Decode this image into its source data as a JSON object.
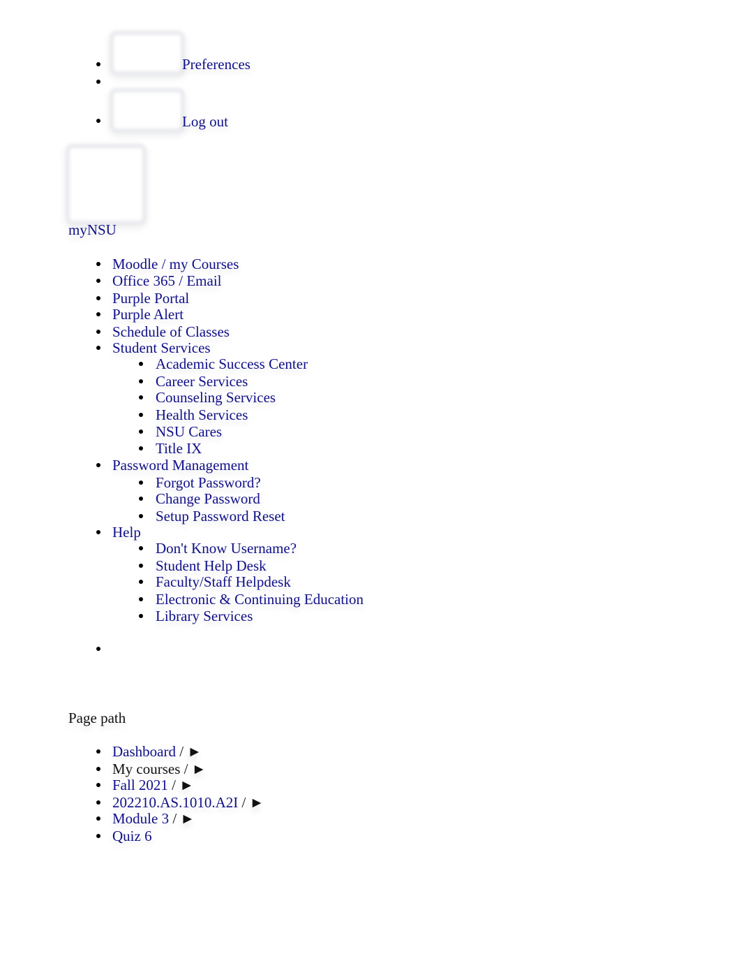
{
  "user_menu": {
    "items": [
      {
        "label": "Preferences",
        "icon": "preferences-icon-placeholder"
      },
      {
        "label": ""
      },
      {
        "label": "Log out",
        "icon": "logout-icon-placeholder"
      }
    ]
  },
  "brand": {
    "logo": "mynsu-logo-placeholder",
    "label": "myNSU"
  },
  "main_nav": {
    "items": [
      {
        "label": "Moodle / my Courses"
      },
      {
        "label": "Office 365 / Email"
      },
      {
        "label": "Purple Portal"
      },
      {
        "label": "Purple Alert"
      },
      {
        "label": "Schedule of Classes"
      },
      {
        "label": "Student Services",
        "children": [
          {
            "label": "Academic Success Center"
          },
          {
            "label": "Career Services"
          },
          {
            "label": "Counseling Services"
          },
          {
            "label": "Health Services"
          },
          {
            "label": "NSU Cares"
          },
          {
            "label": "Title IX"
          }
        ]
      },
      {
        "label": "Password Management",
        "children": [
          {
            "label": "Forgot Password?"
          },
          {
            "label": "Change Password"
          },
          {
            "label": "Setup Password Reset"
          }
        ]
      },
      {
        "label": "Help",
        "children": [
          {
            "label": "Don't Know Username?"
          },
          {
            "label": "Student Help Desk"
          },
          {
            "label": "Faculty/Staff Helpdesk"
          },
          {
            "label": "Electronic & Continuing Education"
          },
          {
            "label": "Library Services"
          }
        ]
      },
      {
        "label": ""
      }
    ]
  },
  "breadcrumb": {
    "heading": "Page path",
    "separator": "/",
    "arrow": "►",
    "items": [
      {
        "label": "Dashboard",
        "link": true
      },
      {
        "label": "My courses",
        "link": false
      },
      {
        "label": "Fall 2021",
        "link": true
      },
      {
        "label": "202210.AS.1010.A2I",
        "link": true
      },
      {
        "label": "Module 3",
        "link": true
      },
      {
        "label": "Quiz 6",
        "link": true
      }
    ]
  }
}
